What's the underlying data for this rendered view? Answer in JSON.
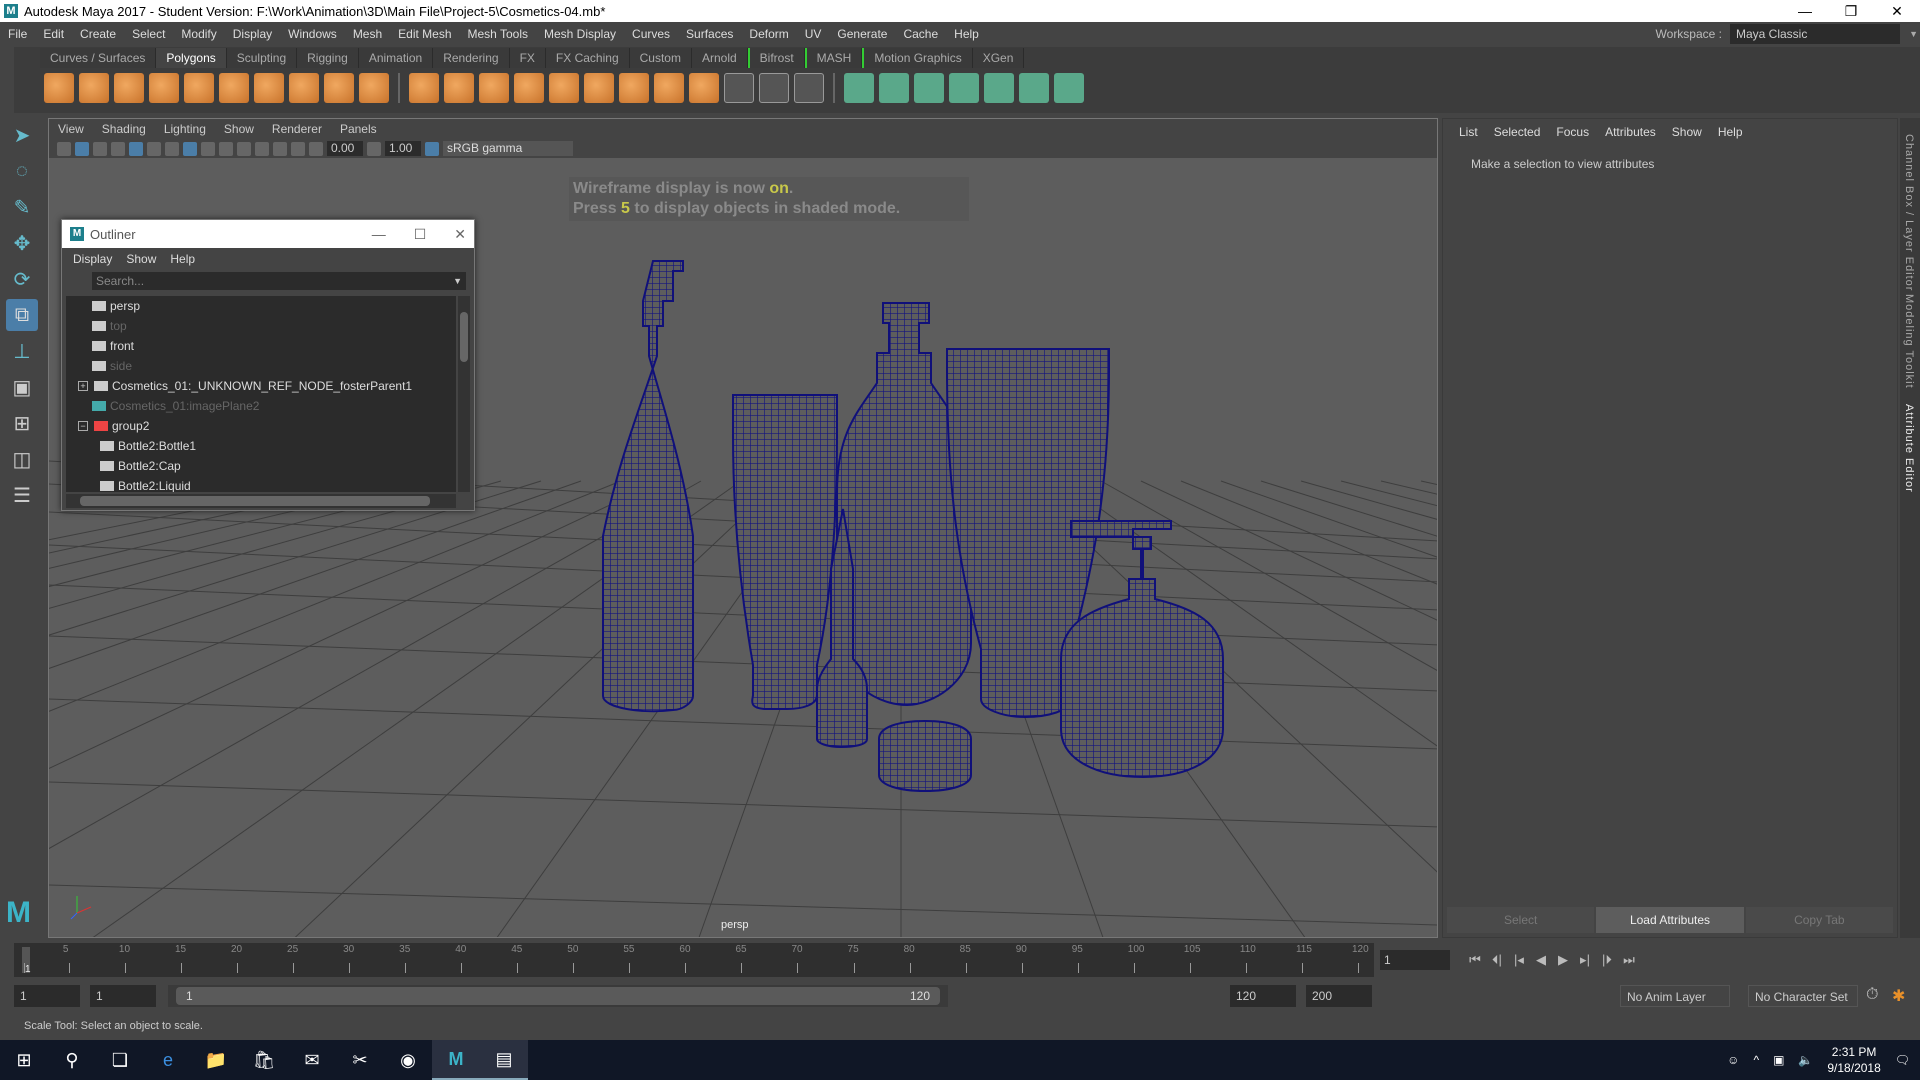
{
  "window": {
    "title": "Autodesk Maya 2017 - Student Version: F:\\Work\\Animation\\3D\\Main File\\Project-5\\Cosmetics-04.mb*",
    "controls": [
      "—",
      "❐",
      "✕"
    ]
  },
  "menubar": [
    "File",
    "Edit",
    "Create",
    "Select",
    "Modify",
    "Display",
    "Windows",
    "Mesh",
    "Edit Mesh",
    "Mesh Tools",
    "Mesh Display",
    "Curves",
    "Surfaces",
    "Deform",
    "UV",
    "Generate",
    "Cache",
    "Help"
  ],
  "workspace": {
    "label": "Workspace :",
    "value": "Maya Classic"
  },
  "shelf": {
    "tabs": [
      "Curves / Surfaces",
      "Polygons",
      "Sculpting",
      "Rigging",
      "Animation",
      "Rendering",
      "FX",
      "FX Caching",
      "Custom",
      "Arnold",
      "Bifrost",
      "MASH",
      "Motion Graphics",
      "XGen"
    ],
    "active": "Polygons",
    "icons": [
      "poly-sphere",
      "poly-cube",
      "poly-cylinder",
      "poly-cone",
      "poly-plane",
      "poly-torus",
      "poly-pyramid",
      "poly-pipe",
      "type",
      "svg",
      "sep",
      "combine",
      "separate",
      "mirror",
      "smooth",
      "boolean",
      "extract",
      "bevel",
      "bridge",
      "extrude",
      "bevel-2",
      "multi-cut",
      "target-weld",
      "sep",
      "uv-planar",
      "uv-cylindrical",
      "uv-spherical",
      "uv-auto",
      "uv-unfold",
      "uv-editor",
      "uv-layout"
    ]
  },
  "toolbox": [
    "select-tool",
    "lasso-tool",
    "paint-select-tool",
    "move-tool",
    "rotate-tool",
    "scale-tool",
    "soft-mod-tool",
    "single-view",
    "four-view",
    "two-view",
    "outliner-view"
  ],
  "viewport": {
    "menu": [
      "View",
      "Shading",
      "Lighting",
      "Show",
      "Renderer",
      "Panels"
    ],
    "exposure": "0.00",
    "gamma": "1.00",
    "color_space": "sRGB gamma",
    "hud_line1": "Wireframe display is now ",
    "hud_on": "on",
    "hud_line1_end": ".",
    "hud_line2_a": "Press ",
    "hud_key": "5",
    "hud_line2_b": " to display objects in shaded mode.",
    "camera": "persp",
    "wire_color": "#14147f"
  },
  "outliner": {
    "title": "Outliner",
    "menu": [
      "Display",
      "Show",
      "Help"
    ],
    "search_placeholder": "Search...",
    "items": [
      {
        "label": "persp",
        "dim": false,
        "type": "camera"
      },
      {
        "label": "top",
        "dim": true,
        "type": "camera"
      },
      {
        "label": "front",
        "dim": false,
        "type": "camera"
      },
      {
        "label": "side",
        "dim": true,
        "type": "camera"
      },
      {
        "label": "Cosmetics_01:_UNKNOWN_REF_NODE_fosterParent1",
        "dim": false,
        "type": "ref",
        "expand": "+"
      },
      {
        "label": "Cosmetics_01:imagePlane2",
        "dim": true,
        "type": "image"
      },
      {
        "label": "group2",
        "dim": false,
        "type": "group",
        "expand": "−"
      },
      {
        "label": "Bottle2:Bottle1",
        "dim": false,
        "type": "mesh"
      },
      {
        "label": "Bottle2:Cap",
        "dim": false,
        "type": "mesh"
      },
      {
        "label": "Bottle2:Liquid",
        "dim": false,
        "type": "mesh"
      }
    ]
  },
  "attribute_editor": {
    "menu": [
      "List",
      "Selected",
      "Focus",
      "Attributes",
      "Show",
      "Help"
    ],
    "message": "Make a selection to view attributes",
    "buttons": [
      "Select",
      "Load Attributes",
      "Copy Tab"
    ]
  },
  "side_tabs": [
    "Channel Box / Layer Editor",
    "Modeling Toolkit",
    "Attribute Editor"
  ],
  "timeline": {
    "start": 1,
    "end": 120,
    "current_frame": "1",
    "label_step": 5
  },
  "range": {
    "start": "1",
    "anim_start": "1",
    "slider_start": "1",
    "slider_end": "120",
    "end": "120",
    "anim_end": "200",
    "anim_layer": "No Anim Layer",
    "character_set": "No Character Set"
  },
  "playback": [
    "⏮",
    "⏴|",
    "|◂",
    "◀",
    "▶",
    "▸|",
    "|⏵",
    "⏭"
  ],
  "help_line": "Scale Tool: Select an object to scale.",
  "taskbar": {
    "apps": [
      "start",
      "search",
      "task-view",
      "edge",
      "file-explorer",
      "store",
      "mail",
      "snipping-tool",
      "chrome",
      "maya",
      "monitor"
    ],
    "time": "2:31 PM",
    "date": "9/18/2018"
  }
}
